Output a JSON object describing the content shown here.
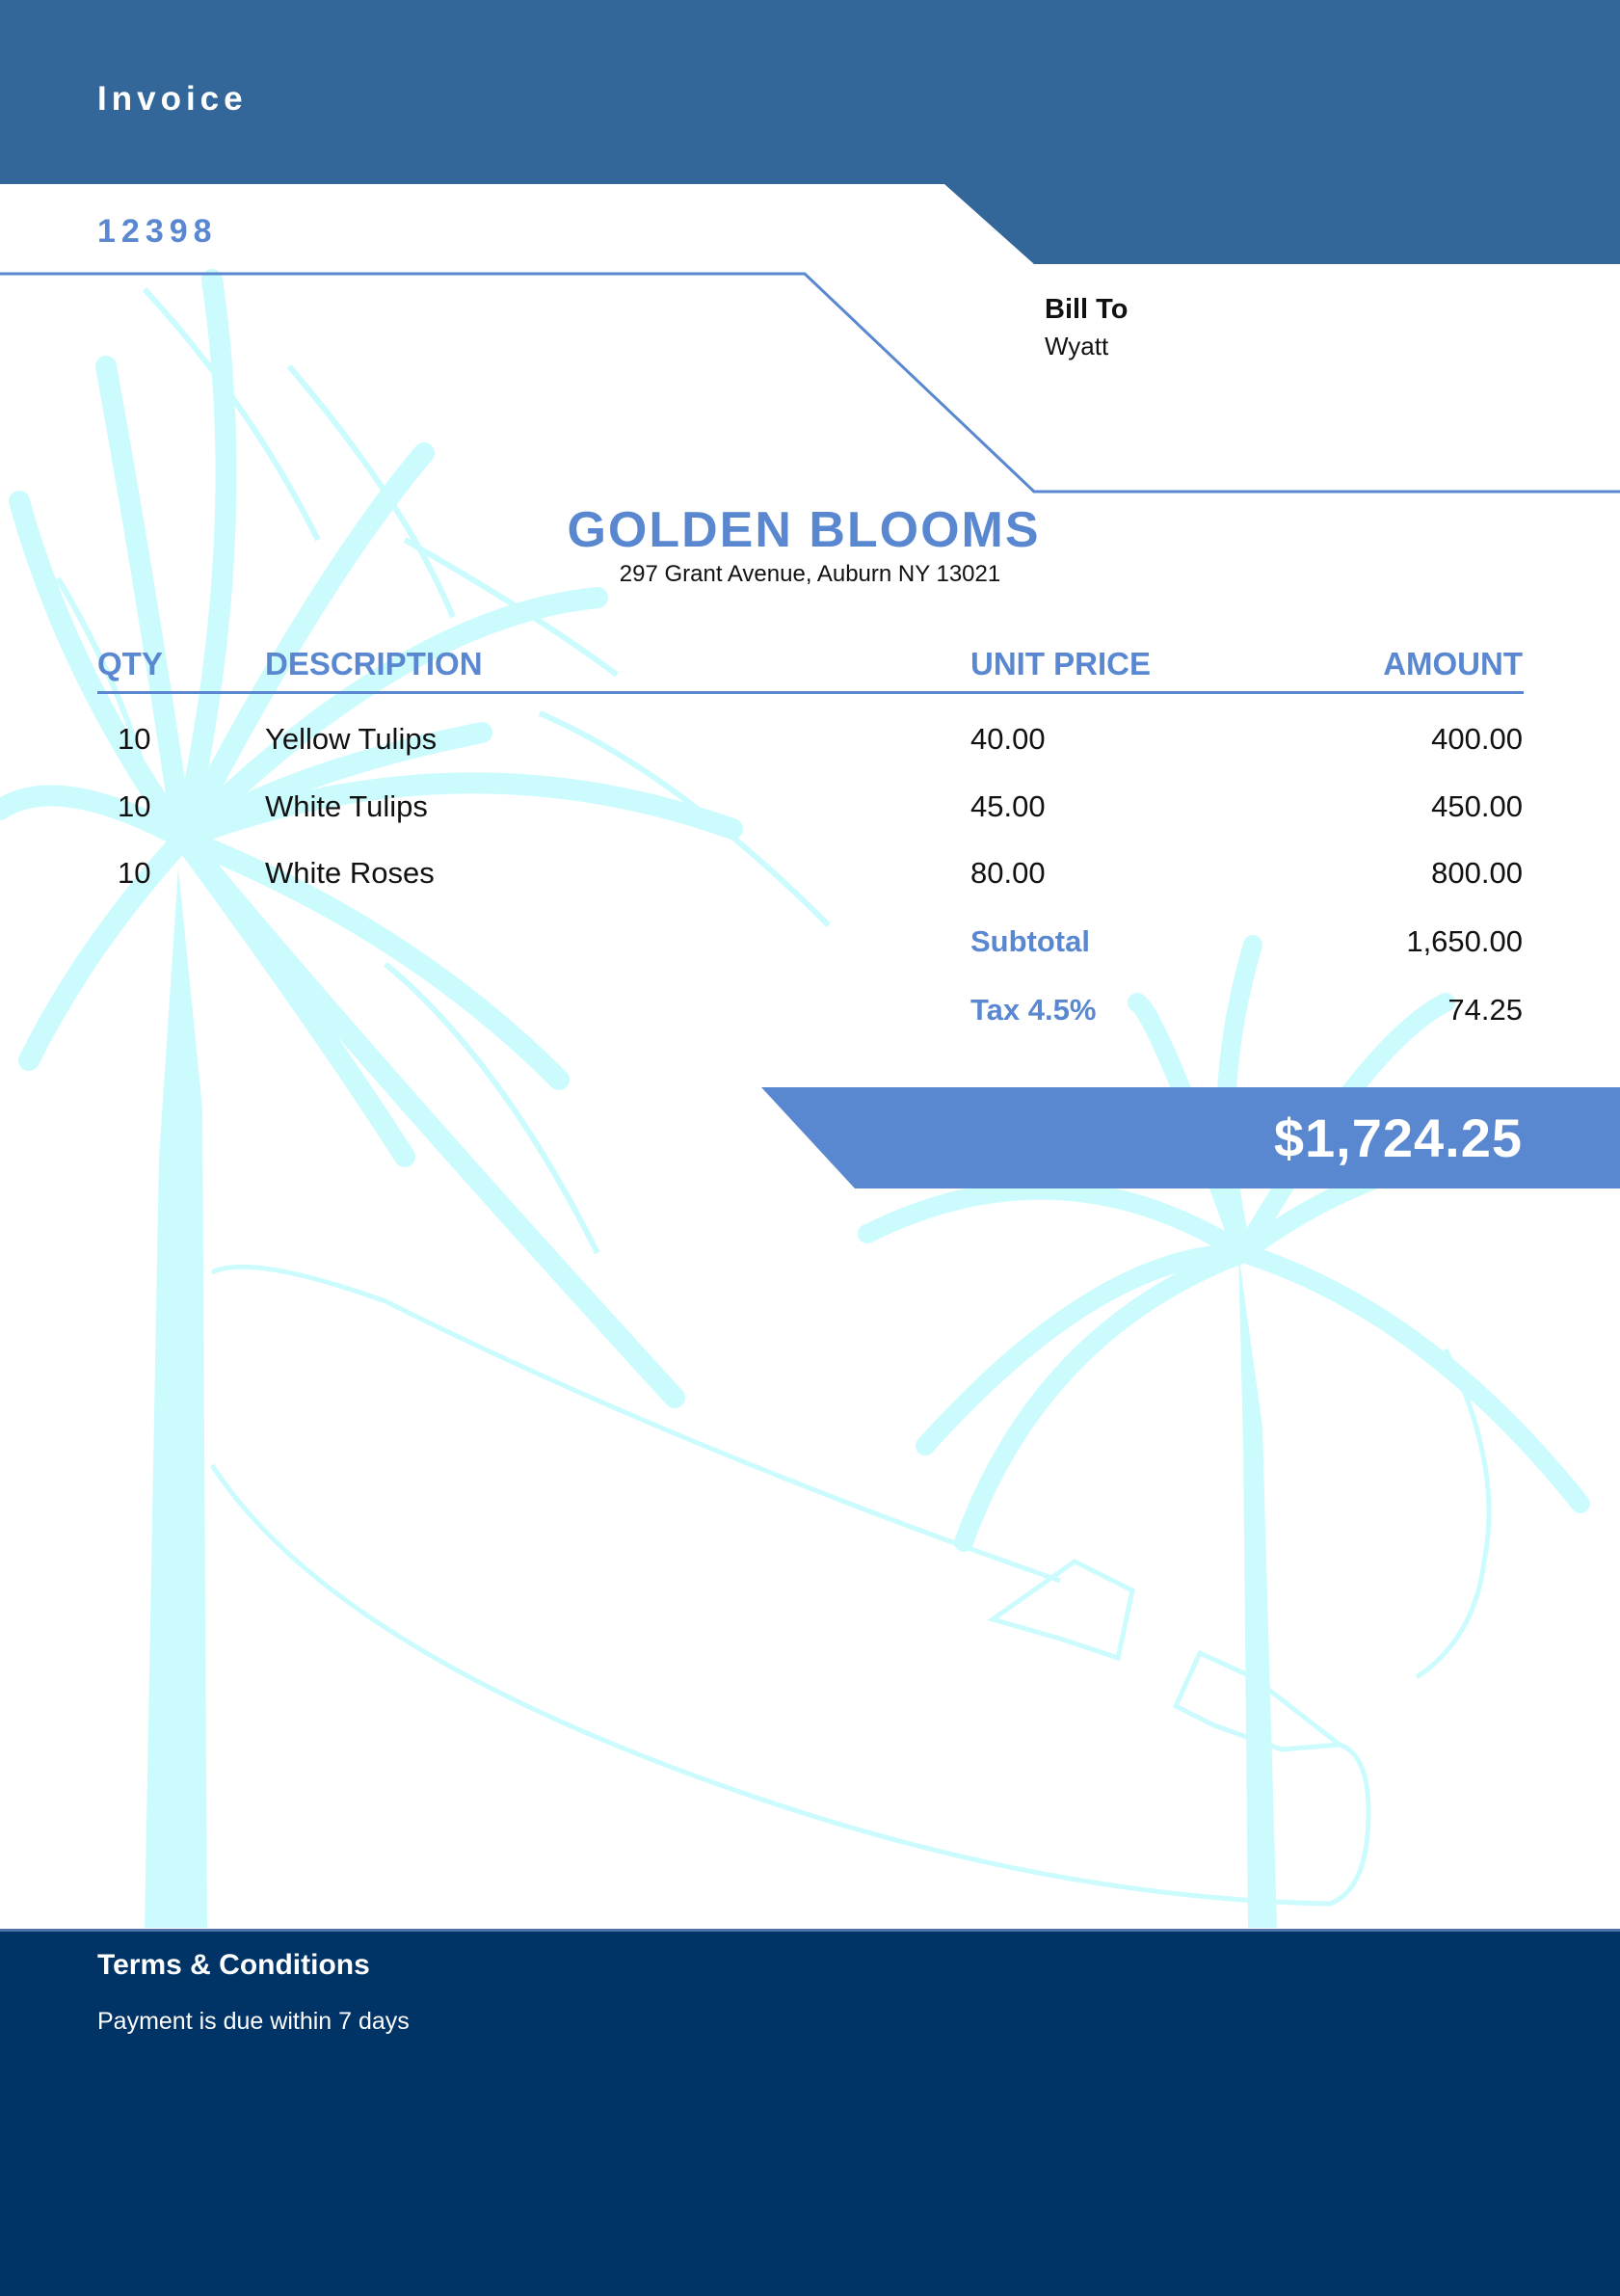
{
  "invoice": {
    "label": "Invoice",
    "number": "12398"
  },
  "bill_to": {
    "heading": "Bill To",
    "name": "Wyatt"
  },
  "company": {
    "name": "GOLDEN BLOOMS",
    "address": "297 Grant Avenue, Auburn NY 13021"
  },
  "table": {
    "columns": [
      "QTY",
      "DESCRIPTION",
      "UNIT PRICE",
      "AMOUNT"
    ],
    "rows": [
      {
        "qty": "10",
        "description": "Yellow Tulips",
        "unit_price": "40.00",
        "amount": "400.00"
      },
      {
        "qty": "10",
        "description": "White Tulips",
        "unit_price": "45.00",
        "amount": "450.00"
      },
      {
        "qty": "10",
        "description": "White Roses",
        "unit_price": "80.00",
        "amount": "800.00"
      }
    ]
  },
  "summary": {
    "subtotal_label": "Subtotal",
    "subtotal_value": "1,650.00",
    "tax_label": "Tax 4.5%",
    "tax_value": "74.25",
    "total_value": "$1,724.25"
  },
  "terms": {
    "heading": "Terms & Conditions",
    "text": "Payment is due within 7 days"
  },
  "colors": {
    "header_band": "#336699",
    "accent": "#5a88d0",
    "total_band": "#5a88d0",
    "footer": "#003366",
    "palm_watermark": "#ccfbfd"
  },
  "watermark": "palm-trees-and-surfboard"
}
